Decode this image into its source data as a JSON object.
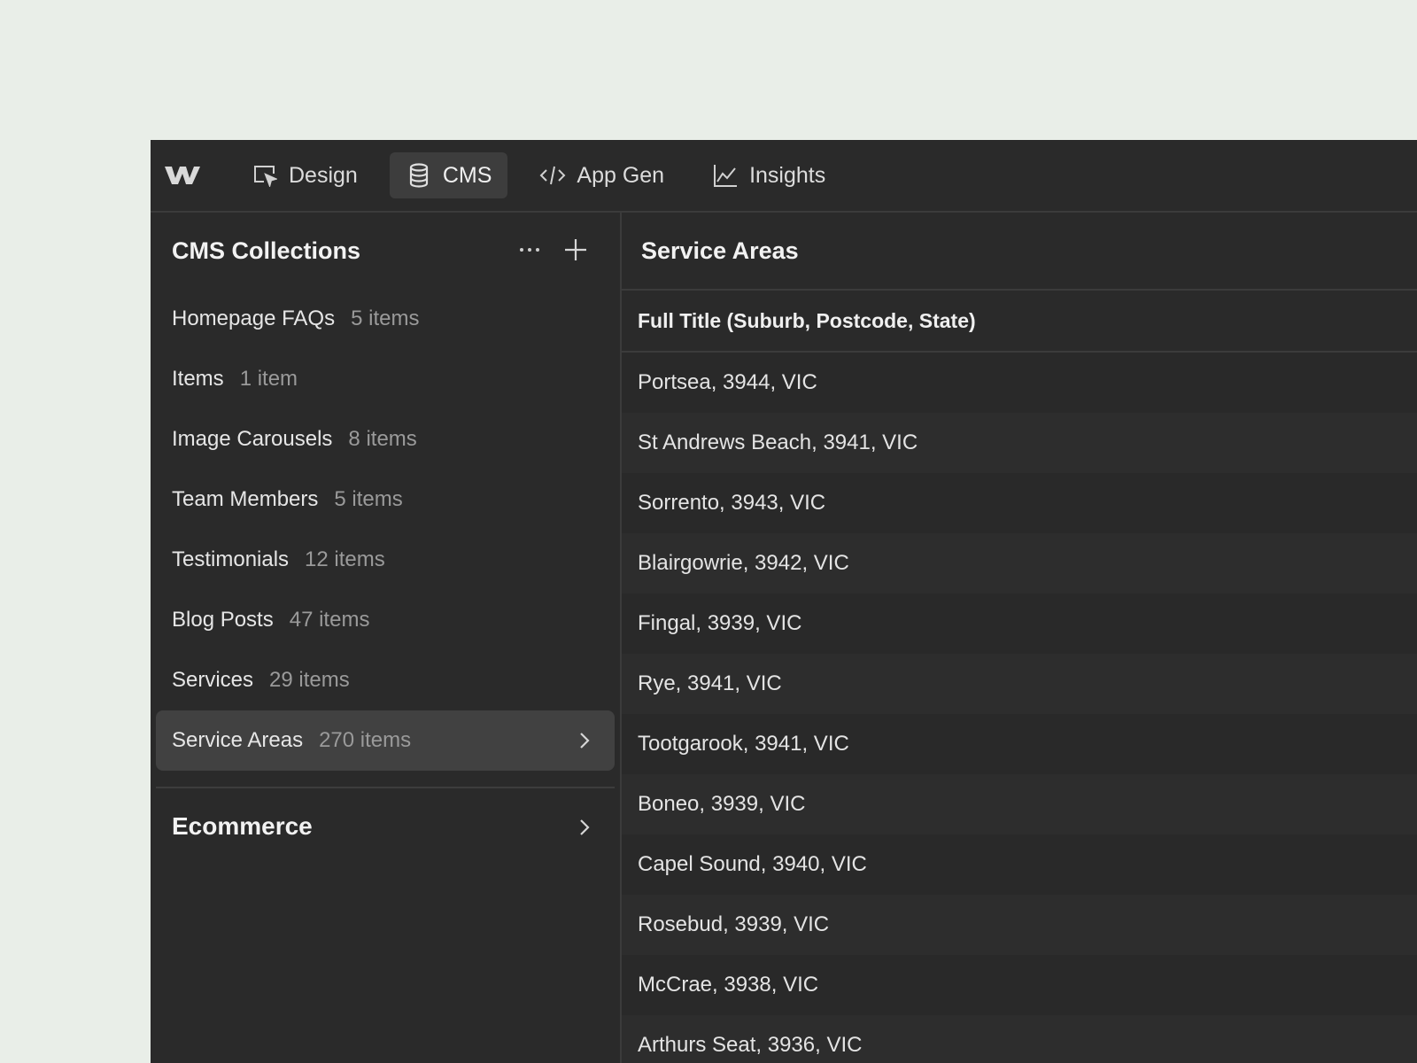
{
  "topbar": {
    "logo_icon": "webflow-logo-icon",
    "tabs": [
      {
        "label": "Design",
        "icon": "design-cursor-icon",
        "active": false
      },
      {
        "label": "CMS",
        "icon": "database-icon",
        "active": true
      },
      {
        "label": "App Gen",
        "icon": "code-icon",
        "active": false
      },
      {
        "label": "Insights",
        "icon": "chart-line-icon",
        "active": false
      }
    ]
  },
  "sidebar": {
    "title": "CMS Collections",
    "actions": [
      "more-icon",
      "plus-icon"
    ],
    "collections": [
      {
        "name": "Homepage FAQs",
        "count": "5 items"
      },
      {
        "name": "Items",
        "count": "1 item"
      },
      {
        "name": "Image Carousels",
        "count": "8 items"
      },
      {
        "name": "Team Members",
        "count": "5 items"
      },
      {
        "name": "Testimonials",
        "count": "12 items"
      },
      {
        "name": "Blog Posts",
        "count": "47 items"
      },
      {
        "name": "Services",
        "count": "29 items"
      },
      {
        "name": "Service Areas",
        "count": "270 items",
        "active": true
      }
    ],
    "ecommerce_label": "Ecommerce"
  },
  "main": {
    "title": "Service Areas",
    "column_header": "Full Title (Suburb, Postcode, State)",
    "rows": [
      "Portsea, 3944, VIC",
      "St Andrews Beach, 3941, VIC",
      "Sorrento, 3943, VIC",
      "Blairgowrie, 3942, VIC",
      "Fingal, 3939, VIC",
      "Rye, 3941, VIC",
      "Tootgarook, 3941, VIC",
      "Boneo, 3939, VIC",
      "Capel Sound, 3940, VIC",
      "Rosebud, 3939, VIC",
      "McCrae, 3938, VIC",
      "Arthurs Seat, 3936, VIC"
    ]
  },
  "colors": {
    "background": "#e9eee8",
    "panel": "#2a2a2a",
    "active_item": "#414141"
  }
}
